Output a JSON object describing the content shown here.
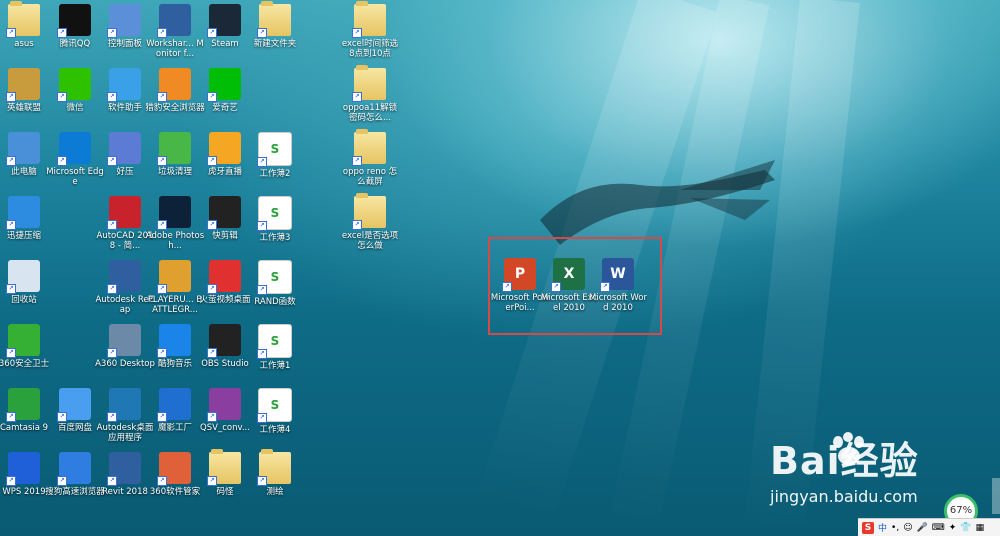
{
  "desktop": {
    "left_icons": [
      {
        "label": "asus",
        "icon": "user-folder-icon",
        "color": "#f2c94c"
      },
      {
        "label": "腾讯QQ",
        "icon": "qq-penguin-icon",
        "color": "#111111"
      },
      {
        "label": "控制面板",
        "icon": "control-panel-icon",
        "color": "#5b8fd8"
      },
      {
        "label": "Workshar... Monitor f...",
        "icon": "revit-r-icon",
        "color": "#2f5f9f"
      },
      {
        "label": "Steam",
        "icon": "steam-icon",
        "color": "#1b2838"
      },
      {
        "label": "新建文件夹",
        "icon": "folder-icon",
        "color": "#e6c462"
      },
      {
        "label": "英雄联盟",
        "icon": "league-icon",
        "color": "#c89b3c"
      },
      {
        "label": "微信",
        "icon": "wechat-icon",
        "color": "#2dc100"
      },
      {
        "label": "软件助手",
        "icon": "software-helper-icon",
        "color": "#3aa0e8"
      },
      {
        "label": "猎豹安全浏览器",
        "icon": "cheetah-browser-icon",
        "color": "#f08a24"
      },
      {
        "label": "爱奇艺",
        "icon": "iqiyi-icon",
        "color": "#00be06"
      },
      {
        "label": "此电脑",
        "icon": "computer-icon",
        "color": "#4a90d9"
      },
      {
        "label": "Microsoft Edge",
        "icon": "edge-icon",
        "color": "#0c7bd5"
      },
      {
        "label": "好压",
        "icon": "haozip-icon",
        "color": "#5b7bd5"
      },
      {
        "label": "垃圾清理",
        "icon": "cleanup-icon",
        "color": "#49b648"
      },
      {
        "label": "虎牙直播",
        "icon": "huya-icon",
        "color": "#f5a623"
      },
      {
        "label": "工作薄2",
        "icon": "spreadsheet-icon",
        "color": "#ffffff"
      },
      {
        "label": "迅捷压缩",
        "icon": "compress-icon",
        "color": "#2d8be0"
      },
      {
        "label": "AutoCAD 2018 - 简...",
        "icon": "autocad-icon",
        "color": "#c8232c"
      },
      {
        "label": "Adobe Photosh...",
        "icon": "photoshop-icon",
        "color": "#0d2238"
      },
      {
        "label": "快剪辑",
        "icon": "kuaijianji-icon",
        "color": "#222222"
      },
      {
        "label": "工作薄3",
        "icon": "spreadsheet-icon",
        "color": "#ffffff"
      },
      {
        "label": "回收站",
        "icon": "recycle-bin-icon",
        "color": "#d8e4ef"
      },
      {
        "label": "Autodesk ReCap",
        "icon": "recap-icon",
        "color": "#2f5f9f"
      },
      {
        "label": "PLAYERU... BATTLEGR...",
        "icon": "pubg-icon",
        "color": "#e0a030"
      },
      {
        "label": "火萤视频桌面",
        "icon": "huoying-icon",
        "color": "#e03030"
      },
      {
        "label": "RAND函数",
        "icon": "spreadsheet-icon",
        "color": "#ffffff"
      },
      {
        "label": "360安全卫士",
        "icon": "360-safe-icon",
        "color": "#35b035"
      },
      {
        "label": "A360 Desktop",
        "icon": "a360-icon",
        "color": "#6c8aa8"
      },
      {
        "label": "酷狗音乐",
        "icon": "kugou-icon",
        "color": "#1a84e8"
      },
      {
        "label": "OBS Studio",
        "icon": "obs-icon",
        "color": "#222222"
      },
      {
        "label": "工作薄1",
        "icon": "spreadsheet-icon",
        "color": "#ffffff"
      },
      {
        "label": "Camtasia 9",
        "icon": "camtasia-icon",
        "color": "#2aa13c"
      },
      {
        "label": "百度网盘",
        "icon": "baidu-netdisk-icon",
        "color": "#4a9ef0"
      },
      {
        "label": "Autodesk桌面应用程序",
        "icon": "autodesk-icon",
        "color": "#1f78b4"
      },
      {
        "label": "魔影工厂",
        "icon": "moying-icon",
        "color": "#1e6fd0"
      },
      {
        "label": "QSV_conv...",
        "icon": "winrar-icon",
        "color": "#8a3fa0"
      },
      {
        "label": "工作薄4",
        "icon": "spreadsheet-icon",
        "color": "#ffffff"
      },
      {
        "label": "WPS 2019",
        "icon": "wps-icon",
        "color": "#1f5fd8"
      },
      {
        "label": "搜狗高速浏览器",
        "icon": "sogou-browser-icon",
        "color": "#2f7de0"
      },
      {
        "label": "Revit 2018",
        "icon": "revit-r-icon",
        "color": "#2f5f9f"
      },
      {
        "label": "360软件管家",
        "icon": "360-manager-icon",
        "color": "#e0603a"
      },
      {
        "label": "码怪",
        "icon": "document-folder-icon",
        "color": "#e6c462"
      },
      {
        "label": "测绘",
        "icon": "document-folder-icon",
        "color": "#e6c462"
      }
    ],
    "right_icons": [
      {
        "label": "excel时间筛选8点到10点",
        "icon": "document-folder-icon",
        "color": "#e6c462"
      },
      {
        "label": "oppoa11解锁密码怎么...",
        "icon": "document-folder-icon",
        "color": "#e6c462"
      },
      {
        "label": "oppo reno 怎么截屏",
        "icon": "document-folder-icon",
        "color": "#e6c462"
      },
      {
        "label": "excel是否选项怎么做",
        "icon": "document-folder-icon",
        "color": "#e6c462"
      }
    ],
    "office_icons": [
      {
        "label": "Microsoft PowerPoi...",
        "icon": "powerpoint-icon",
        "color": "#d24726",
        "letter": "P"
      },
      {
        "label": "Microsoft Excel 2010",
        "icon": "excel-icon",
        "color": "#1e7145",
        "letter": "X"
      },
      {
        "label": "Microsoft Word 2010",
        "icon": "word-icon",
        "color": "#2b579a",
        "letter": "W"
      }
    ]
  },
  "watermark": {
    "brand": "Bai经验",
    "url": "jingyan.baidu.com"
  },
  "gauge": {
    "value": "67%"
  },
  "tray": {
    "ime": "中",
    "items": [
      "ime-icon",
      "punctuation-icon",
      "emoji-icon",
      "mic-icon",
      "keyboard-icon",
      "tools-icon",
      "skin-icon",
      "grid-icon"
    ]
  }
}
